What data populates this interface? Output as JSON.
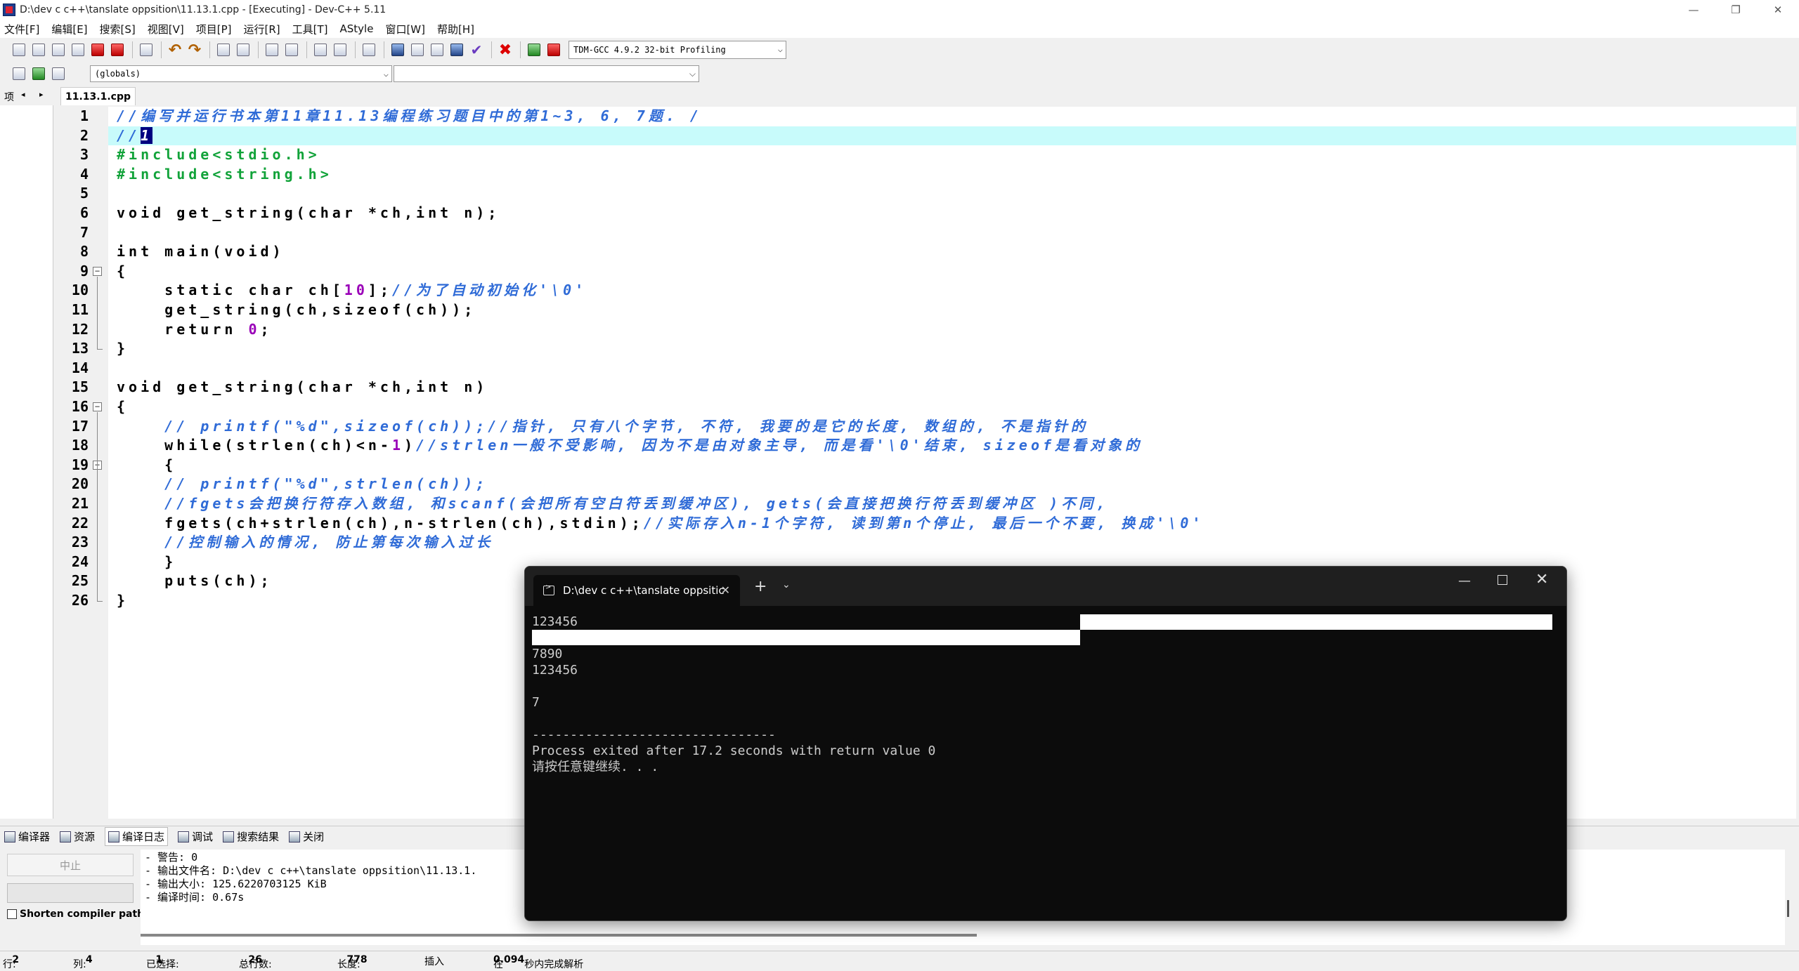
{
  "window": {
    "title": "D:\\dev c c++\\tanslate oppsition\\11.13.1.cpp - [Executing] - Dev-C++ 5.11",
    "minimize": "—",
    "maximize": "❐",
    "close": "✕"
  },
  "menu": [
    "文件[F]",
    "编辑[E]",
    "搜索[S]",
    "视图[V]",
    "项目[P]",
    "运行[R]",
    "工具[T]",
    "AStyle",
    "窗口[W]",
    "帮助[H]"
  ],
  "toolbar": {
    "compiler": "TDM-GCC 4.9.2 32-bit Profiling",
    "scope": "(globals)",
    "member": ""
  },
  "project_tab": {
    "label": "项",
    "left_arrow": "◂",
    "right_arrow": "▸"
  },
  "file_tab": "11.13.1.cpp",
  "editor": {
    "current_line": 2,
    "line_numbers": [
      "1",
      "2",
      "3",
      "4",
      "5",
      "6",
      "7",
      "8",
      "9",
      "10",
      "11",
      "12",
      "13",
      "14",
      "15",
      "16",
      "17",
      "18",
      "19",
      "20",
      "21",
      "22",
      "23",
      "24",
      "25",
      "26"
    ]
  },
  "bottom_tabs": [
    "编译器",
    "资源",
    "编译日志",
    "调试",
    "搜索结果",
    "关闭"
  ],
  "bottom": {
    "abort_label": "中止",
    "shorten_label": "Shorten compiler paths",
    "log_lines": [
      "- 警告: 0",
      "- 输出文件名: D:\\dev c c++\\tanslate oppsition\\11.13.1.",
      "- 输出大小: 125.6220703125 KiB",
      "- 编译时间: 0.67s"
    ]
  },
  "status": {
    "row_label": "行:",
    "row": "2",
    "col_label": "列:",
    "col": "4",
    "sel_label": "已选择:",
    "sel": "1",
    "total_label": "总行数:",
    "total": "26",
    "len_label": "长度:",
    "len": "778",
    "mode": "插入",
    "parse_prefix": "在",
    "parse_time": "0.094",
    "parse_suffix": "秒内完成解析"
  },
  "console": {
    "tab_title": "D:\\dev c c++\\tanslate oppsitic",
    "tab_close": "✕",
    "add": "+",
    "dropdown": "⌄",
    "minimize": "—",
    "close": "✕",
    "lines": [
      "123456",
      "",
      "7890",
      "123456",
      "",
      "7",
      "",
      "--------------------------------",
      "Process exited after 17.2 seconds with return value 0",
      "请按任意键继续. . ."
    ]
  }
}
